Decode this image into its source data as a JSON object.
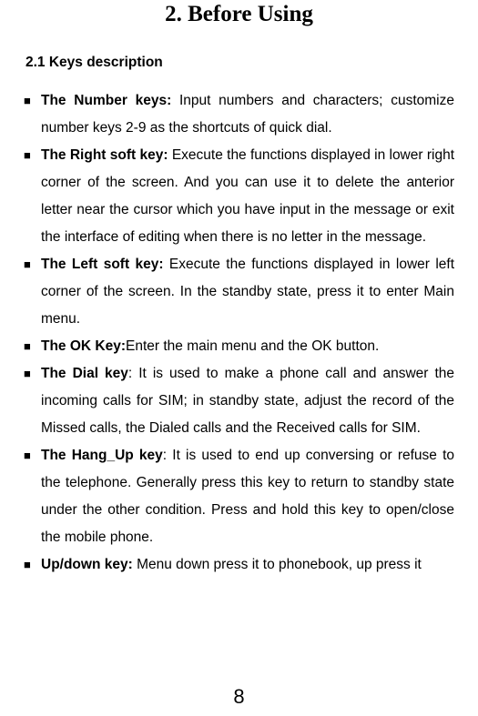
{
  "title": "2. Before Using",
  "section_heading": "2.1 Keys description",
  "items": [
    {
      "label": "The Number keys:",
      "text": " Input numbers and characters; customize number keys 2-9 as the shortcuts of quick dial."
    },
    {
      "label": "The Right soft key:",
      "text": " Execute the functions displayed in lower right corner of the screen. And you can use it to delete the anterior letter near the cursor which you have input in the message or exit the interface of editing when there is no letter in the message."
    },
    {
      "label": "The Left soft key:",
      "text": " Execute the functions displayed in lower left corner of the screen. In the standby state, press it to enter Main menu."
    },
    {
      "label": "The OK Key:",
      "text": "Enter the main menu and the OK button."
    },
    {
      "label": "The Dial key",
      "text": ": It is used to make a phone call and answer the incoming calls for SIM; in standby state, adjust the record of the Missed calls, the Dialed calls and the Received calls for SIM."
    },
    {
      "label": "The Hang_Up key",
      "text": ": It is used to end up conversing or refuse to the telephone. Generally press this key to return to standby state under the other condition. Press and hold this key to open/close the mobile phone."
    },
    {
      "label": "Up/down key:",
      "text": " Menu down press it to phonebook,   up press it"
    }
  ],
  "page_number": "8"
}
